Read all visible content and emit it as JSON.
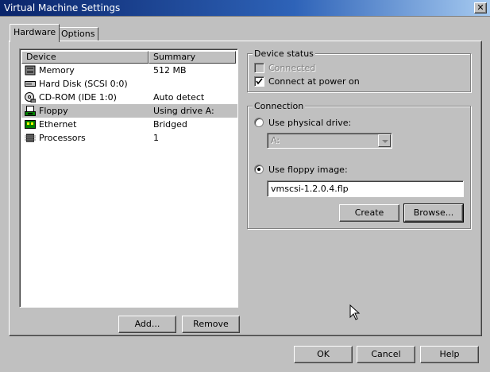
{
  "window": {
    "title": "Virtual Machine Settings",
    "close_glyph": "✕"
  },
  "tabs": [
    {
      "label": "Hardware",
      "active": true
    },
    {
      "label": "Options",
      "active": false
    }
  ],
  "device_list": {
    "columns": [
      "Device",
      "Summary"
    ],
    "rows": [
      {
        "device": "Memory",
        "summary": "512 MB",
        "icon": "memory-icon",
        "selected": false
      },
      {
        "device": "Hard Disk (SCSI 0:0)",
        "summary": "",
        "icon": "hard-disk-icon",
        "selected": false
      },
      {
        "device": "CD-ROM (IDE 1:0)",
        "summary": "Auto detect",
        "icon": "cdrom-icon",
        "selected": false
      },
      {
        "device": "Floppy",
        "summary": "Using drive A:",
        "icon": "floppy-icon",
        "selected": true
      },
      {
        "device": "Ethernet",
        "summary": "Bridged",
        "icon": "ethernet-icon",
        "selected": false
      },
      {
        "device": "Processors",
        "summary": "1",
        "icon": "processor-icon",
        "selected": false
      }
    ]
  },
  "list_buttons": {
    "add": "Add...",
    "remove": "Remove"
  },
  "device_status": {
    "legend": "Device status",
    "connected": {
      "label": "Connected",
      "checked": false,
      "enabled": false
    },
    "connect_at_power_on": {
      "label": "Connect at power on",
      "checked": true,
      "enabled": true
    }
  },
  "connection": {
    "legend": "Connection",
    "use_physical_drive": {
      "label": "Use physical drive:",
      "selected": false
    },
    "drive_select": {
      "value": "A:",
      "enabled": false
    },
    "use_floppy_image": {
      "label": "Use floppy image:",
      "selected": true
    },
    "image_path": {
      "value": "vmscsi-1.2.0.4.flp"
    },
    "create_label": "Create",
    "browse_label": "Browse..."
  },
  "footer": {
    "ok": "OK",
    "cancel": "Cancel",
    "help": "Help"
  },
  "colors": {
    "face": "#c0c0c0",
    "title_start": "#0a246a",
    "title_end": "#a6caf0",
    "selected_row": "#c0c0c0"
  }
}
